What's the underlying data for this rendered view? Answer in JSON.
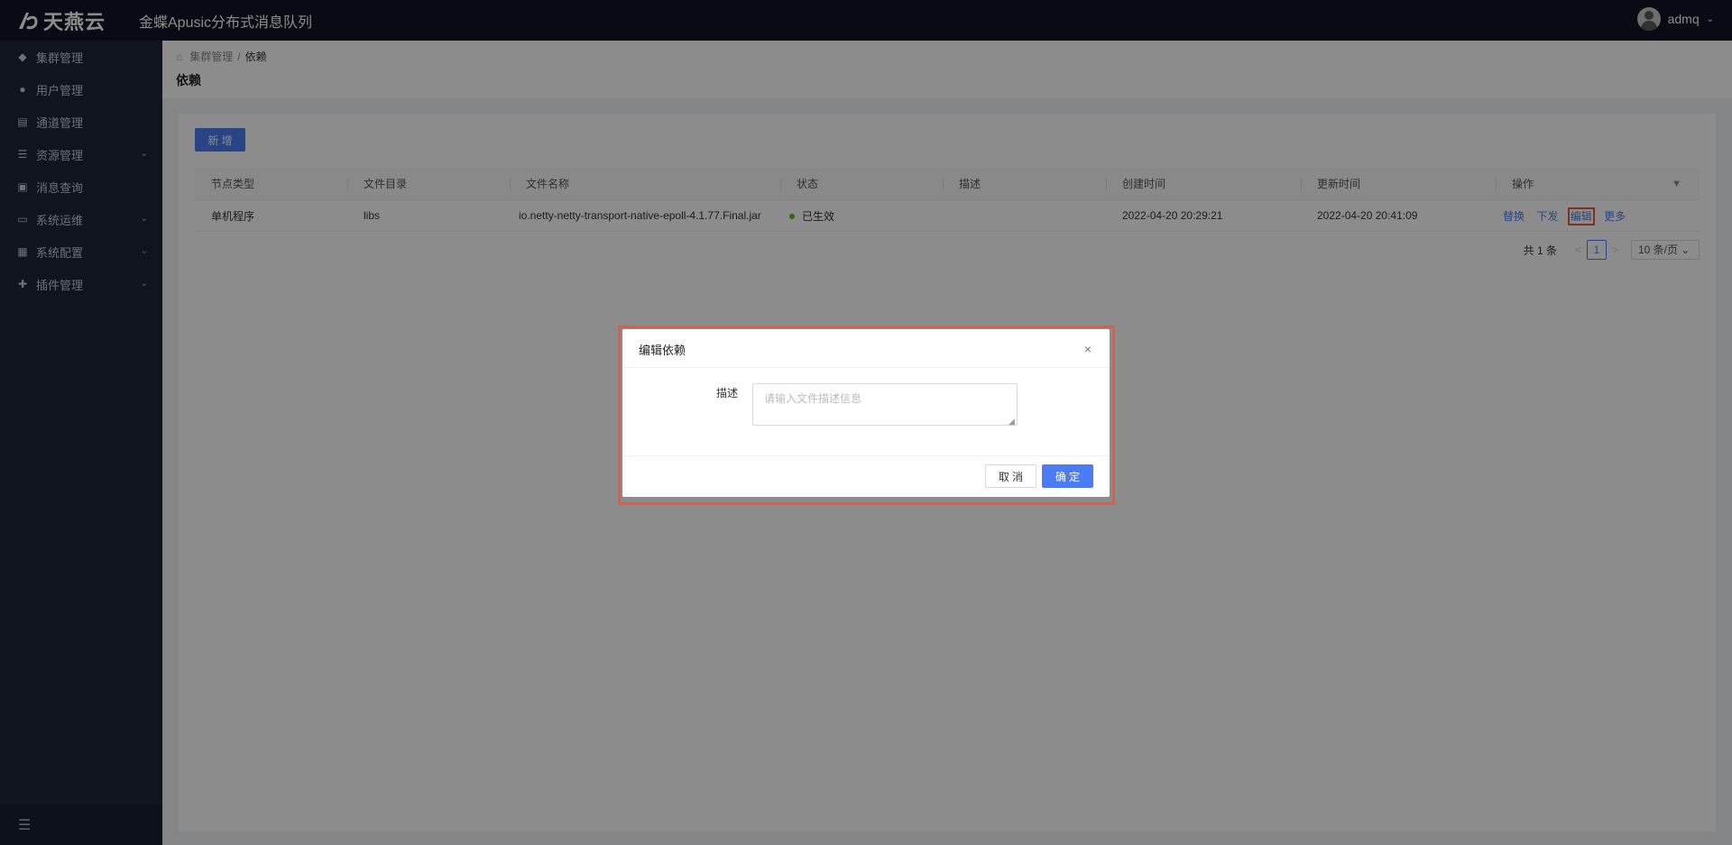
{
  "header": {
    "logo_text": "天燕云",
    "app_title": "金蝶Apusic分布式消息队列",
    "user_name": "admq",
    "user_caret": "⌄"
  },
  "sidebar": {
    "items": [
      {
        "label": "集群管理",
        "icon": "cube-icon",
        "glyph": "◆",
        "has_arrow": false
      },
      {
        "label": "用户管理",
        "icon": "user-icon",
        "glyph": "●",
        "has_arrow": false
      },
      {
        "label": "通道管理",
        "icon": "channel-icon",
        "glyph": "▤",
        "has_arrow": false
      },
      {
        "label": "资源管理",
        "icon": "resource-icon",
        "glyph": "☰",
        "has_arrow": true
      },
      {
        "label": "消息查询",
        "icon": "document-icon",
        "glyph": "▣",
        "has_arrow": false
      },
      {
        "label": "系统运维",
        "icon": "dashboard-icon",
        "glyph": "▭",
        "has_arrow": true
      },
      {
        "label": "系统配置",
        "icon": "config-icon",
        "glyph": "▦",
        "has_arrow": true
      },
      {
        "label": "插件管理",
        "icon": "plugin-icon",
        "glyph": "✚",
        "has_arrow": true
      }
    ],
    "arrow_glyph": "⌄",
    "collapse_glyph": "☰"
  },
  "breadcrumb": {
    "home_glyph": "⌂",
    "parent": "集群管理",
    "separator": "/",
    "current": "依赖"
  },
  "page_title": "依赖",
  "toolbar": {
    "add_label": "新 增"
  },
  "table": {
    "columns": [
      "节点类型",
      "文件目录",
      "文件名称",
      "状态",
      "描述",
      "创建时间",
      "更新时间",
      "操作"
    ],
    "filter_glyph": "▼",
    "rows": [
      {
        "node_type": "单机程序",
        "directory": "libs",
        "file_name": "io.netty-netty-transport-native-epoll-4.1.77.Final.jar",
        "status": "已生效",
        "description": "",
        "created": "2022-04-20 20:29:21",
        "updated": "2022-04-20 20:41:09",
        "actions": [
          "替换",
          "下发",
          "编辑",
          "更多"
        ]
      }
    ]
  },
  "pagination": {
    "total": "共 1 条",
    "prev": "<",
    "current_page": "1",
    "next": ">",
    "page_size": "10 条/页 ⌄"
  },
  "modal": {
    "title": "编辑依赖",
    "close_glyph": "×",
    "field_label": "描述",
    "field_placeholder": "请输入文件描述信息",
    "resize_glyph": "◢",
    "cancel_label": "取 消",
    "ok_label": "确 定"
  },
  "colors": {
    "primary": "#4c7cf3",
    "header_bg": "#0f1525",
    "sidebar_bg": "#1d2536",
    "highlight": "#e85a3c",
    "status_ok": "#52c41a"
  }
}
